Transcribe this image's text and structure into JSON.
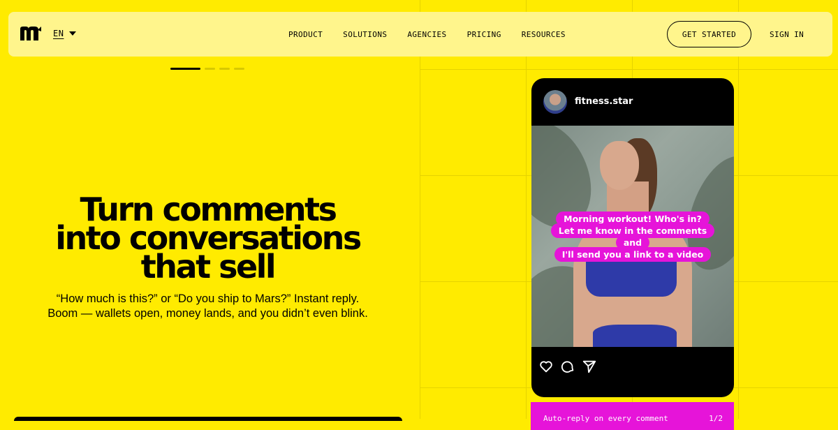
{
  "nav": {
    "lang": "EN",
    "menu": [
      {
        "label": "PRODUCT"
      },
      {
        "label": "SOLUTIONS"
      },
      {
        "label": "AGENCIES"
      },
      {
        "label": "PRICING"
      },
      {
        "label": "RESOURCES"
      }
    ],
    "cta_label": "GET STARTED",
    "signin_label": "SIGN IN"
  },
  "carousel": {
    "active_index": 0,
    "count": 4
  },
  "hero": {
    "headline_line1": "Turn comments",
    "headline_line2": "into conversations",
    "headline_line3": "that sell",
    "subtitle_line1": "“How much is this?” or “Do you ship to Mars?” Instant reply.",
    "subtitle_line2": "Boom — wallets open, money lands, and you didn’t even blink."
  },
  "post": {
    "username": "fitness.star",
    "caption_line1": "Morning workout! Who's in?",
    "caption_line2": "Let me know in the comments and",
    "caption_line3": "I'll send you a link to a video"
  },
  "feature_card": {
    "text": "Auto-reply on every comment",
    "page": "1/2"
  },
  "colors": {
    "background": "#FFEB00",
    "nav_bg": "#FFF58C",
    "accent_pink": "#E614D9",
    "phone_bg": "#000000"
  },
  "icons": [
    "logo-icon",
    "chevron-down-icon",
    "heart-icon",
    "comment-icon",
    "send-icon"
  ]
}
